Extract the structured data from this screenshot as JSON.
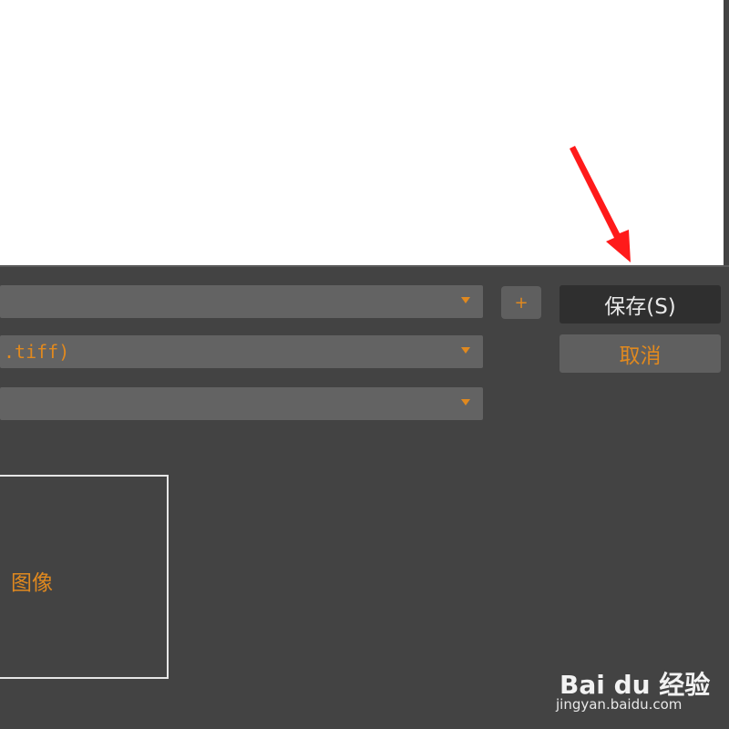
{
  "dialog": {
    "file_type_value": ".tiff)",
    "save_label": "保存(S)",
    "cancel_label": "取消",
    "add_label": "+",
    "preview_label": "图像"
  },
  "watermark": {
    "logo": "Bai du 经验",
    "url": "jingyan.baidu.com"
  },
  "colors": {
    "background": "#434343",
    "accent": "#e0891f",
    "annotation_arrow": "#ff1a1a"
  }
}
